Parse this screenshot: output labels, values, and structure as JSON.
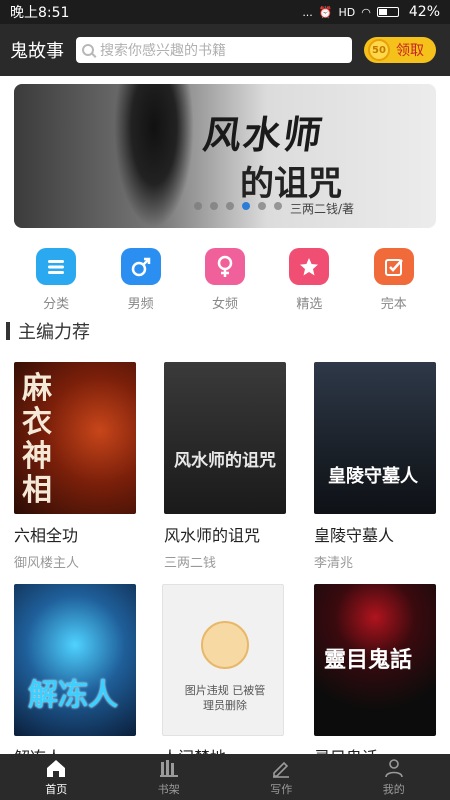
{
  "status_bar": {
    "time": "晚上8:51",
    "signal_text": "...",
    "hd": "HD",
    "battery": "42%"
  },
  "header": {
    "title": "鬼故事",
    "search_placeholder": "搜索你感兴趣的书籍",
    "claim_coin": "50",
    "claim_label": "领取"
  },
  "banner": {
    "title": "风水师",
    "subtitle": "的诅咒",
    "author": "三两二钱/著",
    "dot_count": 6,
    "active_dot": 4
  },
  "categories": [
    {
      "label": "分类",
      "icon": "list-icon",
      "color": "#2aa8f0"
    },
    {
      "label": "男频",
      "icon": "male-icon",
      "color": "#2a8ff0"
    },
    {
      "label": "女频",
      "icon": "female-icon",
      "color": "#f0609a"
    },
    {
      "label": "精选",
      "icon": "star-icon",
      "color": "#f04e73"
    },
    {
      "label": "完本",
      "icon": "check-icon",
      "color": "#f06a3a"
    }
  ],
  "section": {
    "title": "主编力荐"
  },
  "books": [
    {
      "title": "六相全功",
      "author": "御风楼主人",
      "cover_text": "麻衣神相"
    },
    {
      "title": "风水师的诅咒",
      "author": "三两二钱",
      "cover_text": "风水师的诅咒"
    },
    {
      "title": "皇陵守墓人",
      "author": "李清兆",
      "cover_text": "皇陵守墓人"
    },
    {
      "title": "解冻人",
      "author": "",
      "cover_text": "解冻人"
    },
    {
      "title": "人间禁地",
      "author": "",
      "cover_text": "图片违规 已被管理员删除"
    },
    {
      "title": "灵目鬼话",
      "author": "",
      "cover_text": "靈目鬼話"
    }
  ],
  "tabbar": [
    {
      "label": "首页",
      "icon": "home-icon",
      "active": true
    },
    {
      "label": "书架",
      "icon": "bookshelf-icon",
      "active": false
    },
    {
      "label": "写作",
      "icon": "pen-icon",
      "active": false
    },
    {
      "label": "我的",
      "icon": "user-icon",
      "active": false
    }
  ]
}
